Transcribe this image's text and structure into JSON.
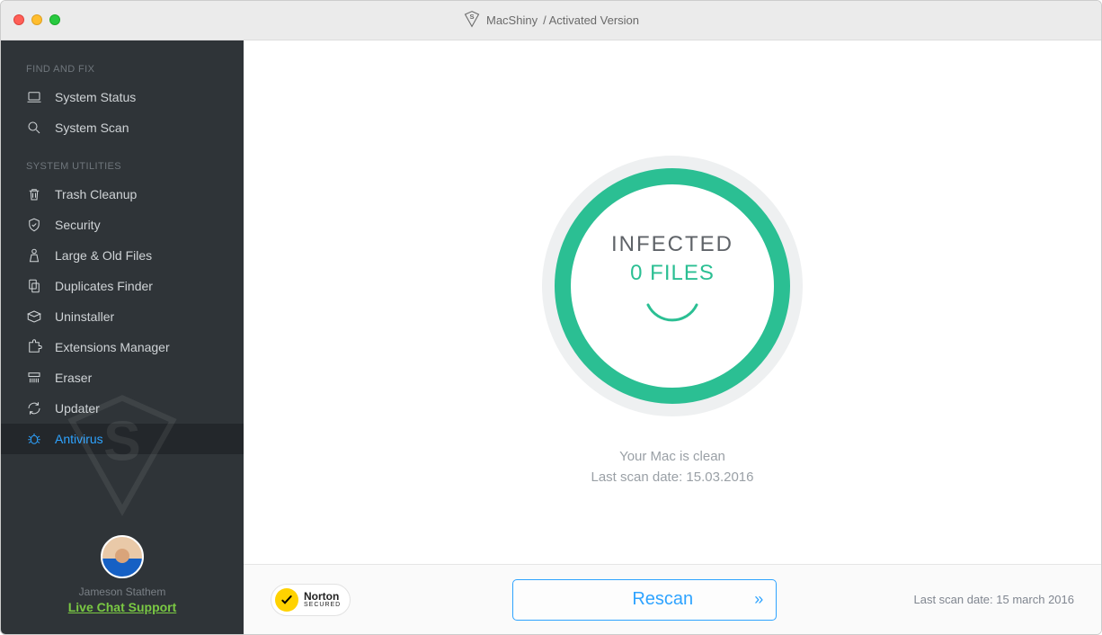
{
  "title": {
    "app": "MacShiny",
    "suffix": "/ Activated Version"
  },
  "sidebar": {
    "section1_label": "FIND AND FIX",
    "section2_label": "SYSTEM UTILITIES",
    "items1": [
      {
        "label": "System Status"
      },
      {
        "label": "System Scan"
      }
    ],
    "items2": [
      {
        "label": "Trash Cleanup"
      },
      {
        "label": "Security"
      },
      {
        "label": "Large & Old Files"
      },
      {
        "label": "Duplicates Finder"
      },
      {
        "label": "Uninstaller"
      },
      {
        "label": "Extensions Manager"
      },
      {
        "label": "Eraser"
      },
      {
        "label": "Updater"
      },
      {
        "label": "Antivirus"
      }
    ],
    "user": {
      "name": "Jameson Stathem",
      "support": "Live Chat Support"
    }
  },
  "main": {
    "ring_label1": "INFECTED",
    "ring_label2": "0 FILES",
    "status_line1": "Your Mac is clean",
    "status_line2": "Last scan date: 15.03.2016"
  },
  "footer": {
    "norton_brand": "Norton",
    "norton_sub": "SECURED",
    "rescan_label": "Rescan",
    "last_scan": "Last scan date: 15 march 2016"
  }
}
